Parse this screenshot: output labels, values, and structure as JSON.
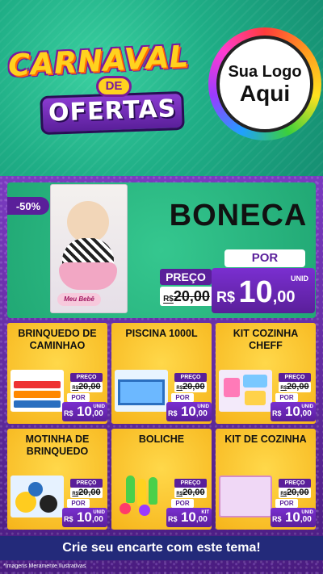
{
  "header": {
    "title_line1": "CARNAVAL",
    "title_de": "DE",
    "title_line2": "OFERTAS",
    "logo_line1": "Sua Logo",
    "logo_line2": "Aqui"
  },
  "featured": {
    "discount": "-50%",
    "name": "BONECA",
    "box_label": "Meu Bebê",
    "preco_label": "PREÇO",
    "old_currency": "R$",
    "old_price": "20,00",
    "por_label": "POR",
    "unid_label": "UNID",
    "currency": "R$",
    "price_int": "10",
    "price_cents": ",00"
  },
  "products": [
    {
      "name": "BRINQUEDO DE CAMINHAO",
      "preco_label": "PREÇO",
      "old_currency": "R$",
      "old_price": "20,00",
      "por_label": "POR",
      "unit": "UNID",
      "currency": "R$",
      "price_int": "10",
      "price_cents": ",00"
    },
    {
      "name": "PISCINA 1000L",
      "preco_label": "PREÇO",
      "old_currency": "R$",
      "old_price": "20,00",
      "por_label": "POR",
      "unit": "UNID",
      "currency": "R$",
      "price_int": "10",
      "price_cents": ",00"
    },
    {
      "name": "KIT COZINHA CHEFF",
      "preco_label": "PREÇO",
      "old_currency": "R$",
      "old_price": "20,00",
      "por_label": "POR",
      "unit": "UNID",
      "currency": "R$",
      "price_int": "10",
      "price_cents": ",00"
    },
    {
      "name": "MOTINHA DE BRINQUEDO",
      "preco_label": "PREÇO",
      "old_currency": "R$",
      "old_price": "20,00",
      "por_label": "POR",
      "unit": "UNID",
      "currency": "R$",
      "price_int": "10",
      "price_cents": ",00"
    },
    {
      "name": "BOLICHE",
      "preco_label": "PREÇO",
      "old_currency": "R$",
      "old_price": "20,00",
      "por_label": "POR",
      "unit": "KIT",
      "currency": "R$",
      "price_int": "10",
      "price_cents": ",00"
    },
    {
      "name": "KIT DE COZINHA",
      "preco_label": "PREÇO",
      "old_currency": "R$",
      "old_price": "20,00",
      "por_label": "POR",
      "unit": "UNID",
      "currency": "R$",
      "price_int": "10",
      "price_cents": ",00"
    }
  ],
  "cta": "Crie seu encarte com este tema!",
  "footnote": "*Imagens Meramente Ilustrativas",
  "colors": {
    "header_green": "#1fae86",
    "panel_purple": "#5a1f9a",
    "card_yellow": "#f6b41a",
    "cta_blue": "#232a7a"
  }
}
